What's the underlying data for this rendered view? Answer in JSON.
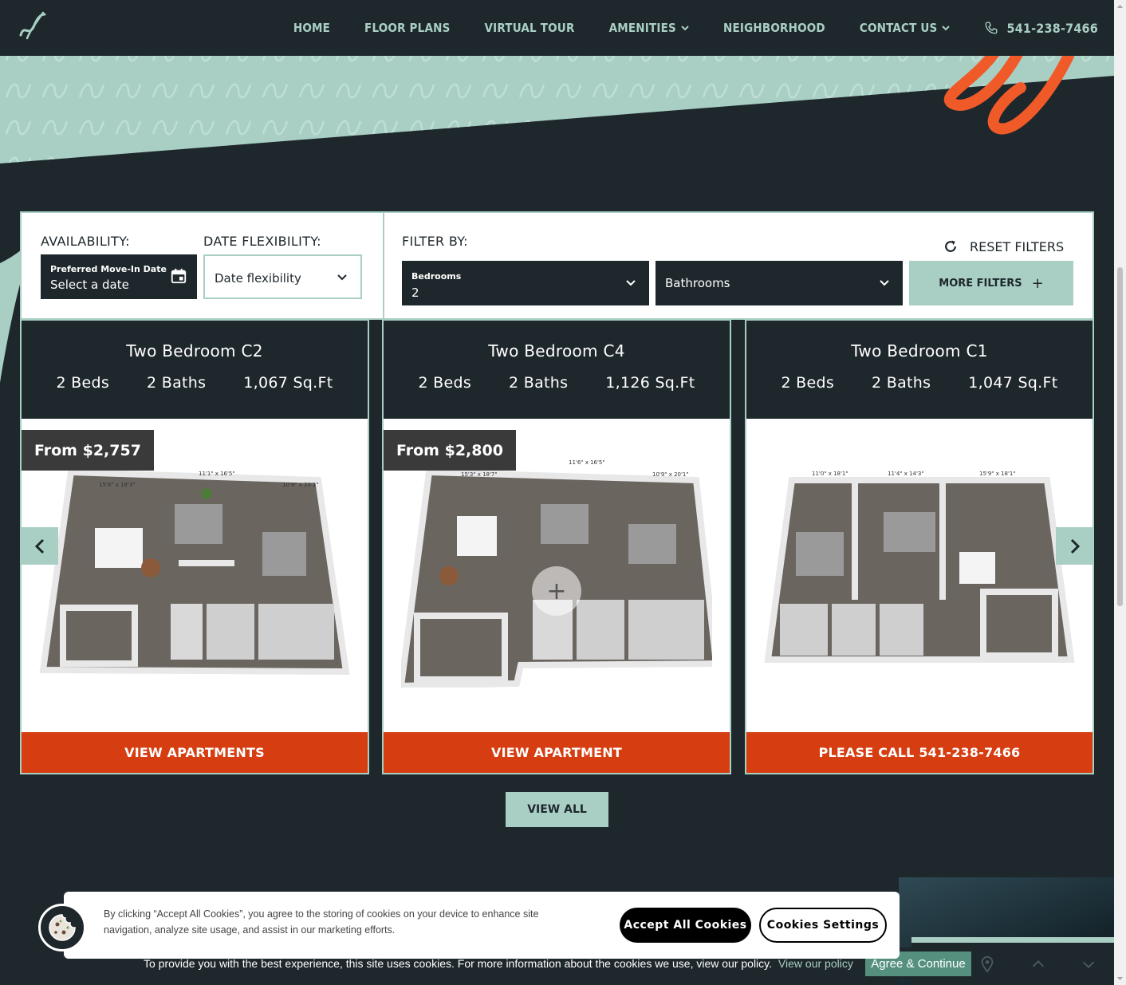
{
  "nav": {
    "items": [
      {
        "label": "HOME",
        "dropdown": false
      },
      {
        "label": "FLOOR PLANS",
        "dropdown": false
      },
      {
        "label": "VIRTUAL TOUR",
        "dropdown": false
      },
      {
        "label": "AMENITIES",
        "dropdown": true
      },
      {
        "label": "NEIGHBORHOOD",
        "dropdown": false
      },
      {
        "label": "CONTACT US",
        "dropdown": true
      }
    ],
    "phone": "541-238-7466"
  },
  "filters": {
    "availability_label": "AVAILABILITY:",
    "movein_small_label": "Preferred Move-In Date",
    "movein_value": "Select a date",
    "flex_label": "DATE FLEXIBILITY:",
    "flex_value": "Date flexibility",
    "filter_by_label": "FILTER BY:",
    "reset_label": "RESET FILTERS",
    "bedrooms_small_label": "Bedrooms",
    "bedrooms_value": "2",
    "bathrooms_value": "Bathrooms",
    "more_filters_label": "MORE FILTERS"
  },
  "cards": [
    {
      "title": "Two Bedroom C2",
      "beds": "2 Beds",
      "baths": "2 Baths",
      "sqft": "1,067 Sq.Ft",
      "price": "From $2,757",
      "button": "VIEW APARTMENTS",
      "dims": [
        "15'8\" x 18'3\"",
        "11'1\" x 16'5\"",
        "10'9\" x 20'1\""
      ]
    },
    {
      "title": "Two Bedroom C4",
      "beds": "2 Beds",
      "baths": "2 Baths",
      "sqft": "1,126 Sq.Ft",
      "price": "From $2,800",
      "button": "VIEW APARTMENT",
      "dims": [
        "15'3\" x 18'7\"",
        "11'6\" x 16'5\"",
        "10'9\" x 20'1\""
      ]
    },
    {
      "title": "Two Bedroom C1",
      "beds": "2 Beds",
      "baths": "2 Baths",
      "sqft": "1,047 Sq.Ft",
      "price": "",
      "button": "PLEASE CALL 541-238-7466",
      "dims": [
        "11'0\" x 18'1\"",
        "11'4\" x 14'3\"",
        "15'9\" x 18'1\""
      ]
    }
  ],
  "view_all_label": "VIEW ALL",
  "cookie_banner": {
    "text": "By clicking “Accept All Cookies”, you agree to the storing of cookies on your device to enhance site navigation, analyze site usage, and assist in our marketing efforts.",
    "accept_label": "Accept All Cookies",
    "settings_label": "Cookies Settings"
  },
  "notice": {
    "text": "To provide you with the best experience, this site uses cookies. For more information about the cookies we use, view our policy.",
    "link": "View our policy",
    "agree_label": "Agree & Continue"
  },
  "colors": {
    "dark": "#1e272c",
    "mint": "#a9cfc4",
    "orange": "#d63d10",
    "accent_orange": "#f05a28"
  }
}
